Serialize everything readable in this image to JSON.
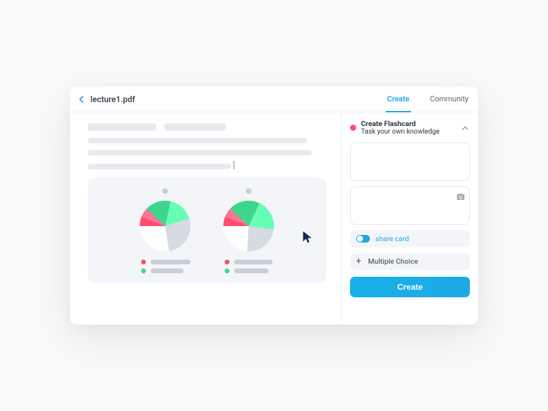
{
  "header": {
    "filename": "lecture1.pdf",
    "tabs": {
      "create": "Create",
      "community": "Community",
      "active": "create"
    }
  },
  "sidebar": {
    "title": "Create Flashcard",
    "subtitle": "Task your own knowledge",
    "share_label": "share card",
    "mc_label": "Multiple Choice",
    "create_button": "Create"
  },
  "colors": {
    "accent": "#1ea7e3",
    "red": "#ff4d6d",
    "green": "#3ed58c",
    "gray": "#d6dae1"
  },
  "chart_data": [
    {
      "type": "pie",
      "series": [
        {
          "name": "red",
          "value": 12,
          "color": "#ff4d6d"
        },
        {
          "name": "green",
          "value": 33,
          "color": "#3ed58c"
        },
        {
          "name": "gray",
          "value": 55,
          "color": "#d6dae1"
        }
      ],
      "legend_bar_widths": [
        58,
        48
      ]
    },
    {
      "type": "pie",
      "series": [
        {
          "name": "red",
          "value": 12,
          "color": "#ff4d6d"
        },
        {
          "name": "green",
          "value": 40,
          "color": "#3ed58c"
        },
        {
          "name": "gray",
          "value": 48,
          "color": "#d6dae1"
        }
      ],
      "legend_bar_widths": [
        56,
        50
      ]
    }
  ]
}
